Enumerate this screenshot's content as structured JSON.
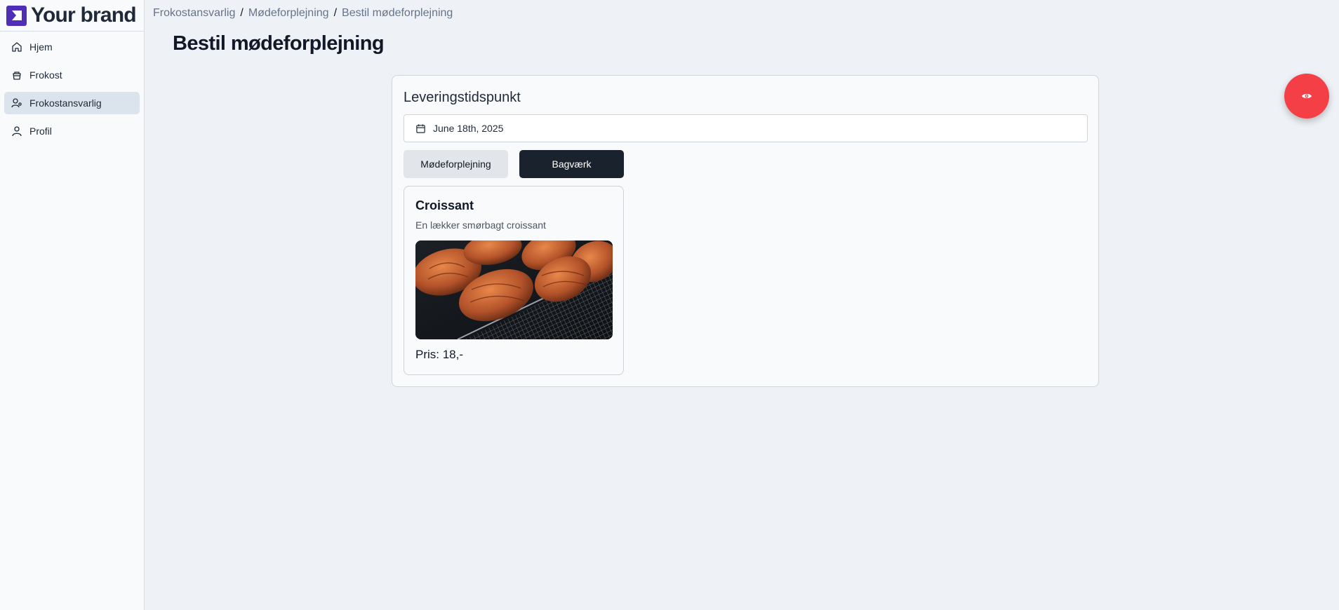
{
  "brand": {
    "name": "Your brand",
    "logo_color": "#4f2fb8"
  },
  "sidebar": {
    "items": [
      {
        "label": "Hjem",
        "icon": "home-icon",
        "active": false
      },
      {
        "label": "Frokost",
        "icon": "lunch-bag-icon",
        "active": false
      },
      {
        "label": "Frokostansvarlig",
        "icon": "user-settings-icon",
        "active": true
      },
      {
        "label": "Profil",
        "icon": "user-icon",
        "active": false
      }
    ]
  },
  "breadcrumb": {
    "items": [
      "Frokostansvarlig",
      "Mødeforplejning",
      "Bestil mødeforplejning"
    ],
    "separator": "/"
  },
  "page": {
    "title": "Bestil mødeforplejning"
  },
  "order": {
    "heading": "Leveringstidspunkt",
    "date_value": "June 18th, 2025",
    "date_icon": "calendar-icon",
    "tabs": [
      {
        "label": "Mødeforplejning",
        "selected": false
      },
      {
        "label": "Bagværk",
        "selected": true
      }
    ]
  },
  "products": [
    {
      "name": "Croissant",
      "description": "En lækker smørbagt croissant",
      "price": "Pris: 18,-",
      "image": "croissants-on-rack-image"
    }
  ],
  "fab": {
    "icon": "eye-icon",
    "color": "#f43f46"
  }
}
